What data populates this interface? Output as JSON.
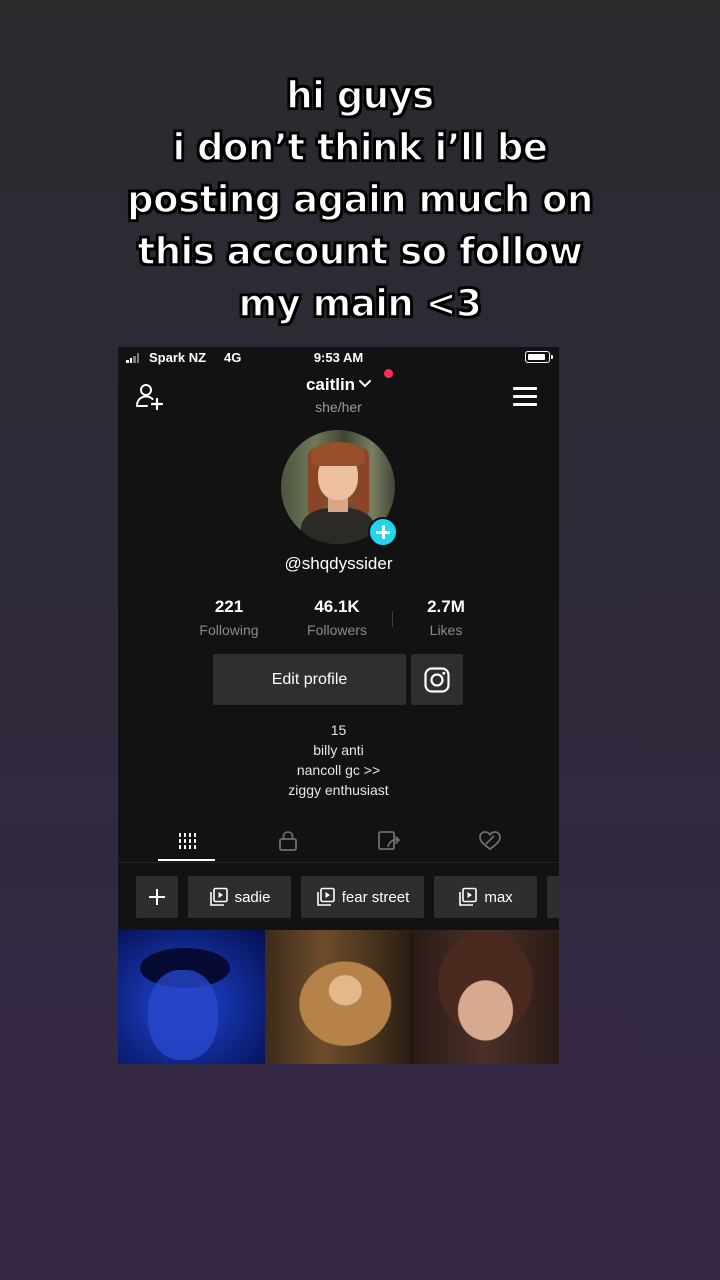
{
  "caption": {
    "lines": [
      "hi guys",
      "i don’t think i’ll be",
      "posting again much on",
      "this account so follow",
      "my main <3"
    ]
  },
  "status_bar": {
    "carrier": "Spark NZ",
    "network": "4G",
    "time": "9:53 AM"
  },
  "header": {
    "username": "caitlin",
    "pronouns": "she/her"
  },
  "profile": {
    "handle": "@shqdyssider",
    "stats": [
      {
        "value": "221",
        "label": "Following"
      },
      {
        "value": "46.1K",
        "label": "Followers"
      },
      {
        "value": "2.7M",
        "label": "Likes"
      }
    ],
    "edit_button_label": "Edit profile",
    "bio": [
      "15",
      "billy anti",
      "nancoll gc >>",
      "ziggy enthusiast"
    ]
  },
  "tabs": [
    "videos-grid-icon",
    "private-lock-icon",
    "reposts-icon",
    "liked-heart-icon"
  ],
  "playlists": [
    "sadie",
    "fear street",
    "max"
  ],
  "colors": {
    "accent_pink": "#fe2c55",
    "accent_cyan": "#20d5ec",
    "surface": "#121212",
    "chip": "#2e2e2e"
  }
}
